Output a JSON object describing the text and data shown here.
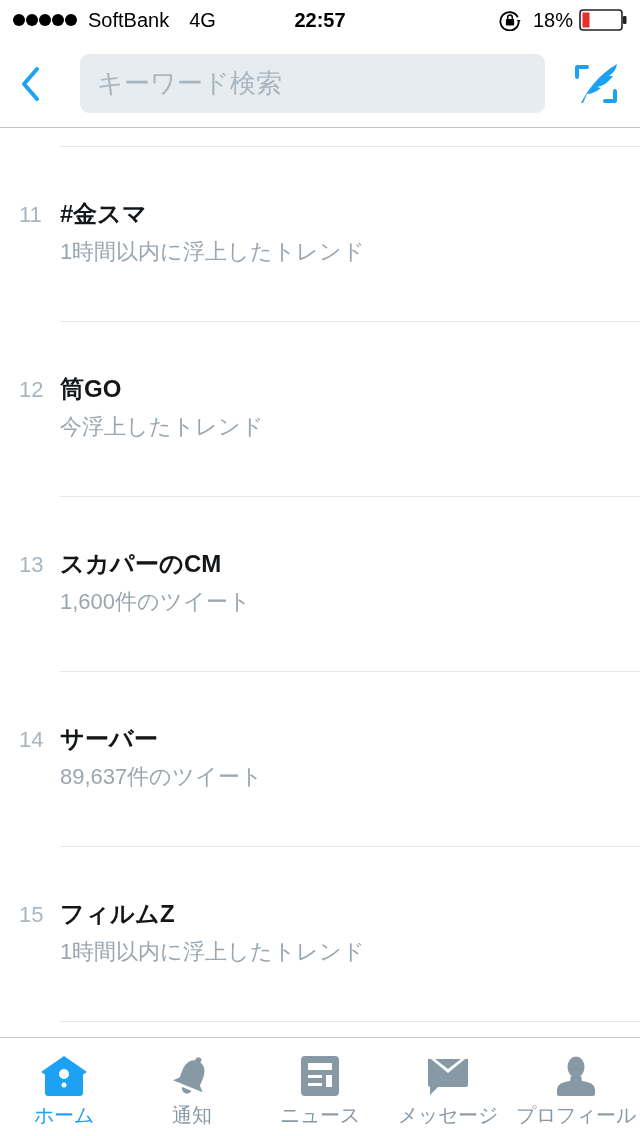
{
  "status_bar": {
    "carrier": "SoftBank",
    "network": "4G",
    "time": "22:57",
    "battery_percent": "18%"
  },
  "nav_bar": {
    "search": {
      "placeholder": "キーワード検索"
    }
  },
  "trends": [
    {
      "rank": "11",
      "title": "#金スマ",
      "subtitle": "1時間以内に浮上したトレンド"
    },
    {
      "rank": "12",
      "title": "筒GO",
      "subtitle": "今浮上したトレンド"
    },
    {
      "rank": "13",
      "title": "スカパーのCM",
      "subtitle": "1,600件のツイート"
    },
    {
      "rank": "14",
      "title": "サーバー",
      "subtitle": "89,637件のツイート"
    },
    {
      "rank": "15",
      "title": "フィルムZ",
      "subtitle": "1時間以内に浮上したトレンド"
    }
  ],
  "tab_bar": {
    "tabs": [
      {
        "label": "ホーム",
        "selected": true
      },
      {
        "label": "通知",
        "selected": false
      },
      {
        "label": "ニュース",
        "selected": false
      },
      {
        "label": "メッセージ",
        "selected": false
      },
      {
        "label": "プロフィール",
        "selected": false
      }
    ]
  }
}
